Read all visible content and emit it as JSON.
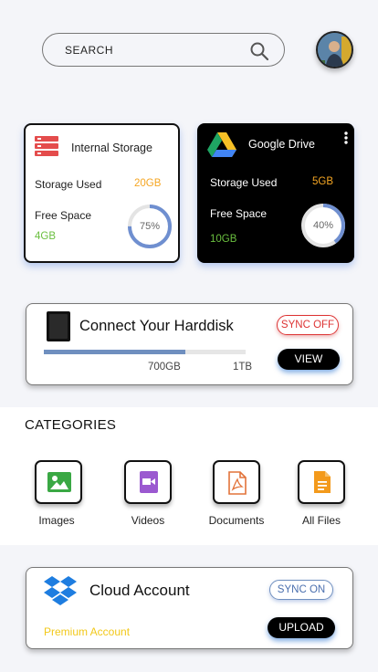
{
  "search": {
    "placeholder": "SEARCH",
    "icon": "search-icon"
  },
  "internal": {
    "title": "Internal Storage",
    "used_label": "Storage Used",
    "used_value": "20GB",
    "free_label": "Free Space",
    "free_value": "4GB",
    "percent_label": "75%",
    "percent": 0.75,
    "icon": "server-icon",
    "colors": {
      "used": "#f5a623",
      "free": "#6abf3f",
      "ring": "#6f8fd0"
    }
  },
  "gdrive": {
    "title": "Google Drive",
    "used_label": "Storage Used",
    "used_value": "5GB",
    "free_label": "Free Space",
    "free_value": "10GB",
    "percent_label": "40%",
    "percent": 0.4,
    "icon": "google-drive-icon",
    "colors": {
      "used": "#f5a623",
      "free": "#6abf3f",
      "ring": "#6f8fd0"
    }
  },
  "harddisk": {
    "title": "Connect Your Harddisk",
    "sync_label": "SYNC OFF",
    "view_label": "VIEW",
    "used_label": "700GB",
    "total_label": "1TB",
    "progress": 0.7,
    "icon": "harddisk-icon"
  },
  "categories": {
    "heading": "CATEGORIES",
    "items": [
      {
        "label": "Images",
        "icon": "image-icon",
        "color": "#3aa844"
      },
      {
        "label": "Videos",
        "icon": "video-icon",
        "color": "#9b59d0"
      },
      {
        "label": "Documents",
        "icon": "pdf-icon",
        "color": "#e2733a"
      },
      {
        "label": "All Files",
        "icon": "file-icon",
        "color": "#f39a1c"
      }
    ]
  },
  "cloud": {
    "title": "Cloud Account",
    "plan": "Premium Account",
    "sync_label": "SYNC ON",
    "upload_label": "UPLOAD",
    "icon": "dropbox-icon"
  }
}
